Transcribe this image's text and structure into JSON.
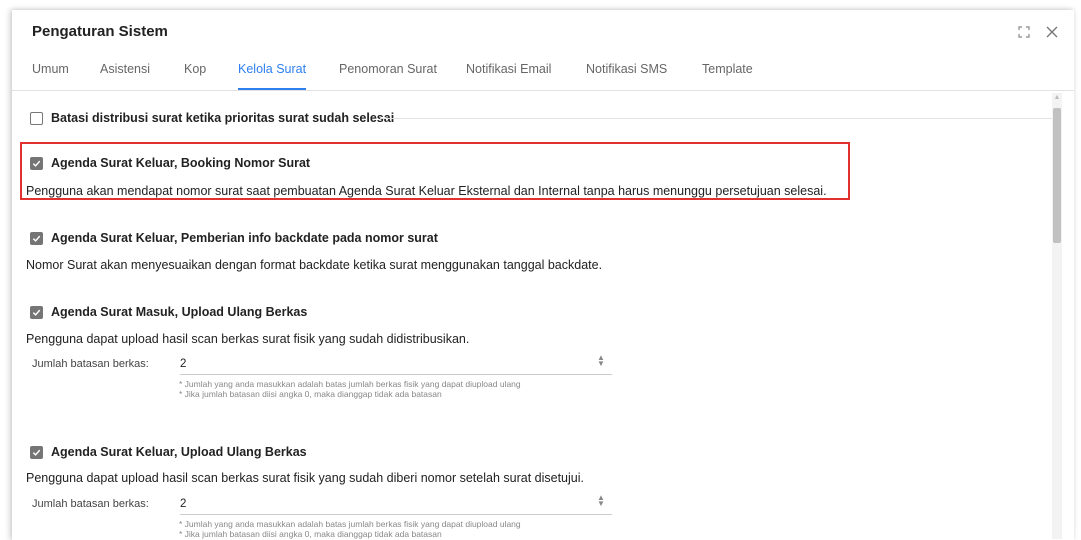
{
  "window": {
    "title": "Pengaturan Sistem",
    "maximize_icon": "maximize-icon",
    "close_icon": "close-icon"
  },
  "tabs": [
    {
      "label": "Umum"
    },
    {
      "label": "Asistensi"
    },
    {
      "label": "Kop"
    },
    {
      "label": "Kelola Surat",
      "active": true
    },
    {
      "label": "Penomoran Surat"
    },
    {
      "label": "Notifikasi Email"
    },
    {
      "label": "Notifikasi SMS"
    },
    {
      "label": "Template"
    }
  ],
  "options": [
    {
      "label": "Batasi distribusi surat ketika prioritas surat sudah selesai",
      "checked": false
    },
    {
      "label": "Agenda Surat Keluar, Booking Nomor Surat",
      "checked": true,
      "highlighted": true,
      "description": "Pengguna akan mendapat nomor surat saat pembuatan Agenda Surat Keluar Eksternal dan Internal tanpa harus menunggu persetujuan selesai."
    },
    {
      "label": "Agenda Surat Keluar, Pemberian info backdate pada nomor surat",
      "checked": true,
      "description": "Nomor Surat akan menyesuaikan dengan format backdate ketika surat menggunakan tanggal backdate."
    },
    {
      "label": "Agenda Surat Masuk, Upload Ulang Berkas",
      "checked": true,
      "description": "Pengguna dapat upload hasil scan berkas surat fisik yang sudah didistribusikan.",
      "field_label": "Jumlah batasan berkas:",
      "field_value": "2",
      "hint1": "* Jumlah yang anda masukkan adalah batas jumlah berkas fisik yang dapat diupload ulang",
      "hint2": "* Jika jumlah batasan diisi angka 0, maka dianggap tidak ada batasan"
    },
    {
      "label": "Agenda Surat Keluar, Upload Ulang Berkas",
      "checked": true,
      "description": "Pengguna dapat upload hasil scan berkas surat fisik yang sudah diberi nomor setelah surat disetujui.",
      "field_label": "Jumlah batasan berkas:",
      "field_value": "2",
      "hint1": "* Jumlah yang anda masukkan adalah batas jumlah berkas fisik yang dapat diupload ulang",
      "hint2": "* Jika jumlah batasan diisi angka 0, maka dianggap tidak ada batasan"
    }
  ],
  "colors": {
    "accent": "#2d7ff0",
    "highlight_border": "#e03030",
    "checkbox_checked": "#757575"
  }
}
